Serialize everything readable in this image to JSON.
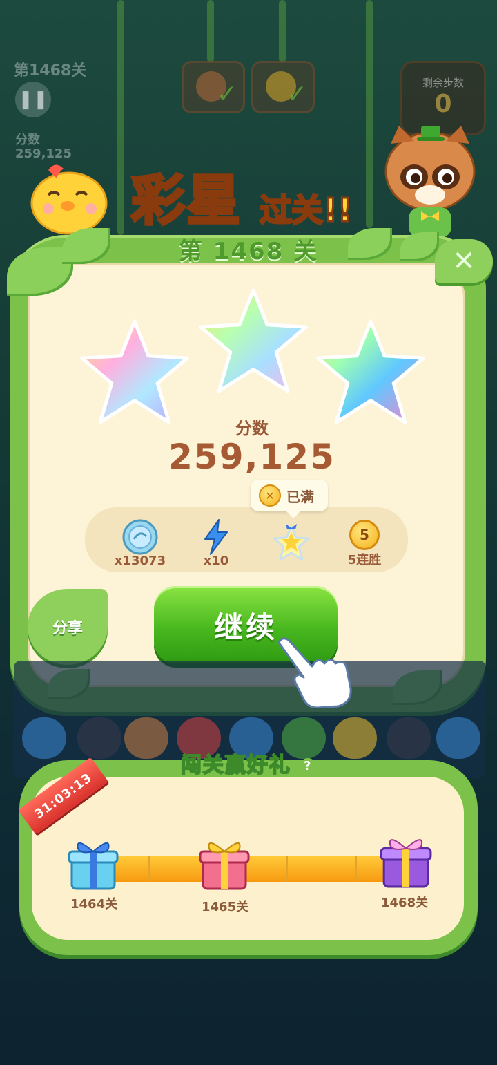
{
  "hud": {
    "level_text": "第1468关",
    "score_label": "分数",
    "score_value": "259,125",
    "moves_label": "剩余步数",
    "moves_value": "0"
  },
  "dialog": {
    "title_main": "彩星",
    "title_sub": "过关!!",
    "level_banner": "第 1468 关",
    "stars_earned": 3,
    "score_label": "分数",
    "score_value": "259,125",
    "tooltip_text": "已满",
    "rewards": [
      {
        "icon": "silver-coin-icon",
        "label": "x13073"
      },
      {
        "icon": "lightning-icon",
        "label": "x10"
      },
      {
        "icon": "star-jar-icon",
        "label": ""
      },
      {
        "icon": "streak-medal-icon",
        "badge": "5",
        "label": "5连胜"
      }
    ],
    "share_label": "分享",
    "continue_label": "继续"
  },
  "event": {
    "title": "闯关赢好礼",
    "help": "?",
    "timer": "31:03:13",
    "progress": 1.0,
    "milestones": [
      {
        "label": "1464关",
        "color": "#5cc8e8"
      },
      {
        "label": "1465关",
        "color": "#f26a8a"
      },
      {
        "label": "1468关",
        "color": "#9a5ae0"
      }
    ]
  }
}
